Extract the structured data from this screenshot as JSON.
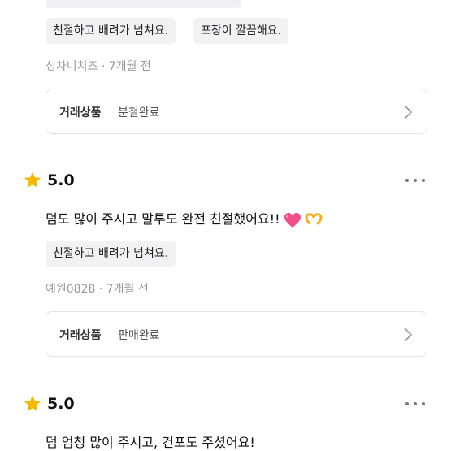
{
  "reviews": [
    {
      "tags": [
        "친절하고 배려가 넘쳐요.",
        "포장이 깔끔해요."
      ],
      "author": "성차니치즈",
      "time": "· 7개월 전",
      "product": {
        "label": "거래상품",
        "status": "분철완료"
      }
    },
    {
      "score": "5.0",
      "text": "덤도 많이 주시고 말투도 완전 친절했어요!!",
      "emojis": [
        "pink-heart-icon",
        "heart-hands-icon"
      ],
      "tags": [
        "친절하고 배려가 넘쳐요."
      ],
      "author": "예원0828",
      "time": "· 7개월 전",
      "product": {
        "label": "거래상품",
        "status": "판매완료"
      }
    },
    {
      "score": "5.0",
      "text": "덤 엄청 많이 주시고, 컨포도 주셨어요!"
    }
  ],
  "colors": {
    "star": "#f5b800",
    "heart": "#f04d8a",
    "chip_bg": "#f2f2f4",
    "border": "#e3e3e3"
  }
}
